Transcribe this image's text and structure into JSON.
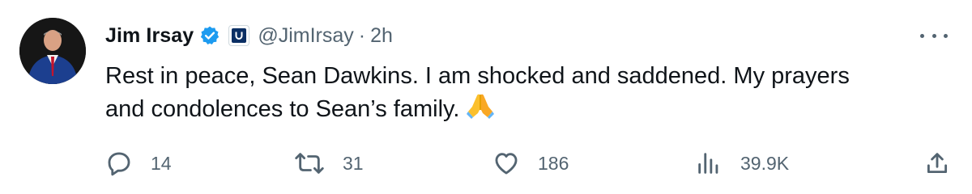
{
  "author": {
    "name": "Jim Irsay",
    "handle": "@JimIrsay",
    "separator": "·",
    "time": "2h",
    "verified": true,
    "affiliate_badge": "colts-horseshoe-icon"
  },
  "tweet": {
    "text_lines": [
      "Rest in peace, Sean Dawkins. I am shocked and saddened. My prayers",
      "and condolences to Sean’s family."
    ],
    "emoji": "folded-hands-emoji"
  },
  "actions": {
    "replies": "14",
    "reposts": "31",
    "likes": "186",
    "views": "39.9K"
  },
  "colors": {
    "text": "#0f1419",
    "muted": "#536471",
    "verified_blue": "#1d9bf0",
    "colts_blue": "#0b2f64"
  }
}
